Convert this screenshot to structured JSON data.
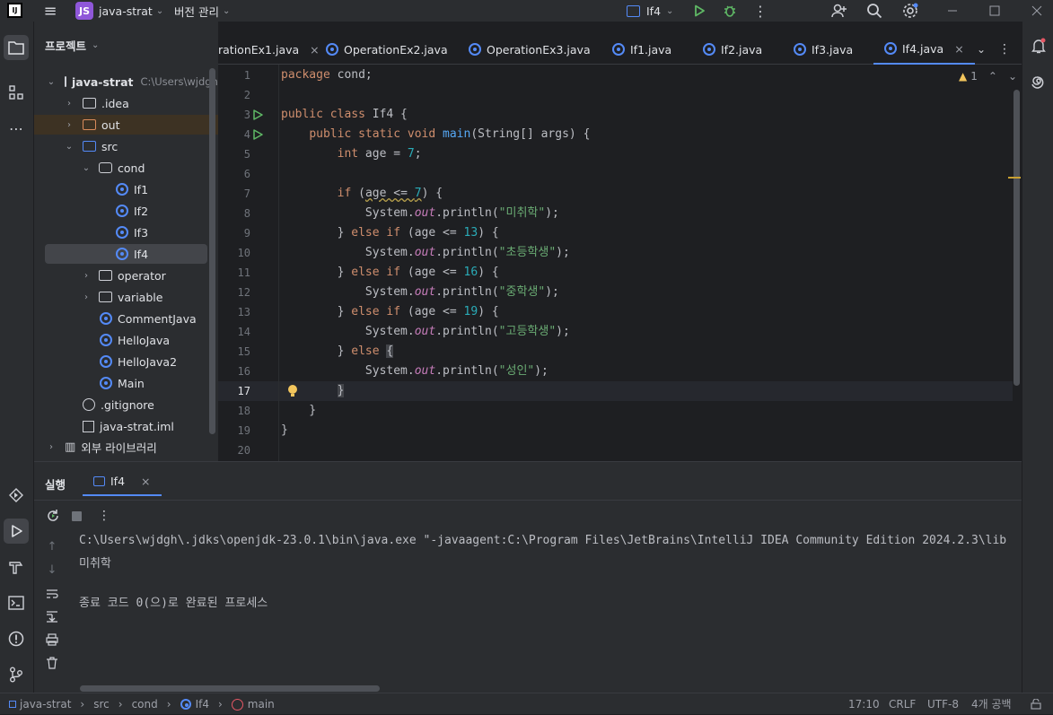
{
  "titlebar": {
    "project_badge": "JS",
    "project_name": "java-strat",
    "vcs_menu": "버전 관리",
    "run_config": "If4"
  },
  "project_panel": {
    "title": "프로젝트",
    "root": {
      "name": "java-strat",
      "path": "C:\\Users\\wjdgh"
    },
    "items": [
      {
        "label": ".idea"
      },
      {
        "label": "out"
      },
      {
        "label": "src"
      },
      {
        "label": "cond"
      },
      {
        "label": "If1"
      },
      {
        "label": "If2"
      },
      {
        "label": "If3"
      },
      {
        "label": "If4"
      },
      {
        "label": "operator"
      },
      {
        "label": "variable"
      },
      {
        "label": "CommentJava"
      },
      {
        "label": "HelloJava"
      },
      {
        "label": "HelloJava2"
      },
      {
        "label": "Main"
      },
      {
        "label": ".gitignore"
      },
      {
        "label": "java-strat.iml"
      },
      {
        "label": "외부 라이브러리"
      }
    ]
  },
  "editor_tabs": [
    {
      "label": "rationEx1.java"
    },
    {
      "label": "OperationEx2.java"
    },
    {
      "label": "OperationEx3.java"
    },
    {
      "label": "If1.java"
    },
    {
      "label": "If2.java"
    },
    {
      "label": "If3.java"
    },
    {
      "label": "If4.java"
    }
  ],
  "editor": {
    "warning_count": "1",
    "line_numbers": [
      "1",
      "2",
      "3",
      "4",
      "5",
      "6",
      "7",
      "8",
      "9",
      "10",
      "11",
      "12",
      "13",
      "14",
      "15",
      "16",
      "17",
      "18",
      "19",
      "20"
    ],
    "current_line": "17"
  },
  "run_panel": {
    "title": "실행",
    "tab": "If4",
    "command": "C:\\Users\\wjdgh\\.jdks\\openjdk-23.0.1\\bin\\java.exe \"-javaagent:C:\\Program Files\\JetBrains\\IntelliJ IDEA Community Edition 2024.2.3\\lib",
    "output": "미취학",
    "exit_message": "종료 코드 0(으)로 완료된 프로세스"
  },
  "statusbar": {
    "crumbs": [
      "java-strat",
      "src",
      "cond",
      "If4",
      "main"
    ],
    "position": "17:10",
    "line_sep": "CRLF",
    "encoding": "UTF-8",
    "indent": "4개 공백"
  },
  "colors": {
    "accent": "#548af7",
    "run": "#5fb865",
    "warning": "#f2c55c"
  }
}
